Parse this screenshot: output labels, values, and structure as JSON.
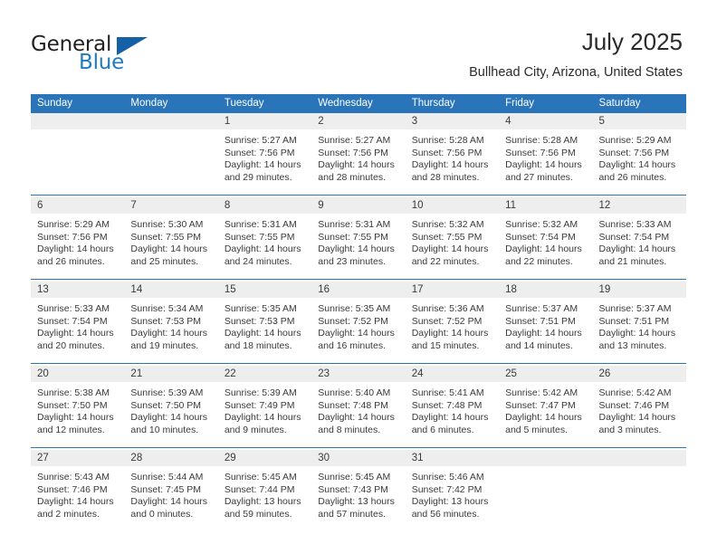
{
  "brand": {
    "word1": "General",
    "word2": "Blue",
    "flag_icon": "triangle-flag-icon",
    "accent_color": "#1f7bc1",
    "flag_color": "#1461a8"
  },
  "header": {
    "title": "July 2025",
    "location": "Bullhead City, Arizona, United States"
  },
  "theme": {
    "header_bg": "#2a74b9",
    "daynum_bg": "#eeeeee",
    "text": "#3a3a3a",
    "separator": "#2a74b9"
  },
  "weekday_headers": [
    "Sunday",
    "Monday",
    "Tuesday",
    "Wednesday",
    "Thursday",
    "Friday",
    "Saturday"
  ],
  "weeks": [
    [
      {
        "day": "",
        "sunrise": "",
        "sunset": "",
        "daylight": "",
        "empty": true
      },
      {
        "day": "",
        "sunrise": "",
        "sunset": "",
        "daylight": "",
        "empty": true
      },
      {
        "day": "1",
        "sunrise": "Sunrise: 5:27 AM",
        "sunset": "Sunset: 7:56 PM",
        "daylight": "Daylight: 14 hours and 29 minutes."
      },
      {
        "day": "2",
        "sunrise": "Sunrise: 5:27 AM",
        "sunset": "Sunset: 7:56 PM",
        "daylight": "Daylight: 14 hours and 28 minutes."
      },
      {
        "day": "3",
        "sunrise": "Sunrise: 5:28 AM",
        "sunset": "Sunset: 7:56 PM",
        "daylight": "Daylight: 14 hours and 28 minutes."
      },
      {
        "day": "4",
        "sunrise": "Sunrise: 5:28 AM",
        "sunset": "Sunset: 7:56 PM",
        "daylight": "Daylight: 14 hours and 27 minutes."
      },
      {
        "day": "5",
        "sunrise": "Sunrise: 5:29 AM",
        "sunset": "Sunset: 7:56 PM",
        "daylight": "Daylight: 14 hours and 26 minutes."
      }
    ],
    [
      {
        "day": "6",
        "sunrise": "Sunrise: 5:29 AM",
        "sunset": "Sunset: 7:56 PM",
        "daylight": "Daylight: 14 hours and 26 minutes."
      },
      {
        "day": "7",
        "sunrise": "Sunrise: 5:30 AM",
        "sunset": "Sunset: 7:55 PM",
        "daylight": "Daylight: 14 hours and 25 minutes."
      },
      {
        "day": "8",
        "sunrise": "Sunrise: 5:31 AM",
        "sunset": "Sunset: 7:55 PM",
        "daylight": "Daylight: 14 hours and 24 minutes."
      },
      {
        "day": "9",
        "sunrise": "Sunrise: 5:31 AM",
        "sunset": "Sunset: 7:55 PM",
        "daylight": "Daylight: 14 hours and 23 minutes."
      },
      {
        "day": "10",
        "sunrise": "Sunrise: 5:32 AM",
        "sunset": "Sunset: 7:55 PM",
        "daylight": "Daylight: 14 hours and 22 minutes."
      },
      {
        "day": "11",
        "sunrise": "Sunrise: 5:32 AM",
        "sunset": "Sunset: 7:54 PM",
        "daylight": "Daylight: 14 hours and 22 minutes."
      },
      {
        "day": "12",
        "sunrise": "Sunrise: 5:33 AM",
        "sunset": "Sunset: 7:54 PM",
        "daylight": "Daylight: 14 hours and 21 minutes."
      }
    ],
    [
      {
        "day": "13",
        "sunrise": "Sunrise: 5:33 AM",
        "sunset": "Sunset: 7:54 PM",
        "daylight": "Daylight: 14 hours and 20 minutes."
      },
      {
        "day": "14",
        "sunrise": "Sunrise: 5:34 AM",
        "sunset": "Sunset: 7:53 PM",
        "daylight": "Daylight: 14 hours and 19 minutes."
      },
      {
        "day": "15",
        "sunrise": "Sunrise: 5:35 AM",
        "sunset": "Sunset: 7:53 PM",
        "daylight": "Daylight: 14 hours and 18 minutes."
      },
      {
        "day": "16",
        "sunrise": "Sunrise: 5:35 AM",
        "sunset": "Sunset: 7:52 PM",
        "daylight": "Daylight: 14 hours and 16 minutes."
      },
      {
        "day": "17",
        "sunrise": "Sunrise: 5:36 AM",
        "sunset": "Sunset: 7:52 PM",
        "daylight": "Daylight: 14 hours and 15 minutes."
      },
      {
        "day": "18",
        "sunrise": "Sunrise: 5:37 AM",
        "sunset": "Sunset: 7:51 PM",
        "daylight": "Daylight: 14 hours and 14 minutes."
      },
      {
        "day": "19",
        "sunrise": "Sunrise: 5:37 AM",
        "sunset": "Sunset: 7:51 PM",
        "daylight": "Daylight: 14 hours and 13 minutes."
      }
    ],
    [
      {
        "day": "20",
        "sunrise": "Sunrise: 5:38 AM",
        "sunset": "Sunset: 7:50 PM",
        "daylight": "Daylight: 14 hours and 12 minutes."
      },
      {
        "day": "21",
        "sunrise": "Sunrise: 5:39 AM",
        "sunset": "Sunset: 7:50 PM",
        "daylight": "Daylight: 14 hours and 10 minutes."
      },
      {
        "day": "22",
        "sunrise": "Sunrise: 5:39 AM",
        "sunset": "Sunset: 7:49 PM",
        "daylight": "Daylight: 14 hours and 9 minutes."
      },
      {
        "day": "23",
        "sunrise": "Sunrise: 5:40 AM",
        "sunset": "Sunset: 7:48 PM",
        "daylight": "Daylight: 14 hours and 8 minutes."
      },
      {
        "day": "24",
        "sunrise": "Sunrise: 5:41 AM",
        "sunset": "Sunset: 7:48 PM",
        "daylight": "Daylight: 14 hours and 6 minutes."
      },
      {
        "day": "25",
        "sunrise": "Sunrise: 5:42 AM",
        "sunset": "Sunset: 7:47 PM",
        "daylight": "Daylight: 14 hours and 5 minutes."
      },
      {
        "day": "26",
        "sunrise": "Sunrise: 5:42 AM",
        "sunset": "Sunset: 7:46 PM",
        "daylight": "Daylight: 14 hours and 3 minutes."
      }
    ],
    [
      {
        "day": "27",
        "sunrise": "Sunrise: 5:43 AM",
        "sunset": "Sunset: 7:46 PM",
        "daylight": "Daylight: 14 hours and 2 minutes."
      },
      {
        "day": "28",
        "sunrise": "Sunrise: 5:44 AM",
        "sunset": "Sunset: 7:45 PM",
        "daylight": "Daylight: 14 hours and 0 minutes."
      },
      {
        "day": "29",
        "sunrise": "Sunrise: 5:45 AM",
        "sunset": "Sunset: 7:44 PM",
        "daylight": "Daylight: 13 hours and 59 minutes."
      },
      {
        "day": "30",
        "sunrise": "Sunrise: 5:45 AM",
        "sunset": "Sunset: 7:43 PM",
        "daylight": "Daylight: 13 hours and 57 minutes."
      },
      {
        "day": "31",
        "sunrise": "Sunrise: 5:46 AM",
        "sunset": "Sunset: 7:42 PM",
        "daylight": "Daylight: 13 hours and 56 minutes."
      },
      {
        "day": "",
        "sunrise": "",
        "sunset": "",
        "daylight": "",
        "empty": true
      },
      {
        "day": "",
        "sunrise": "",
        "sunset": "",
        "daylight": "",
        "empty": true
      }
    ]
  ]
}
